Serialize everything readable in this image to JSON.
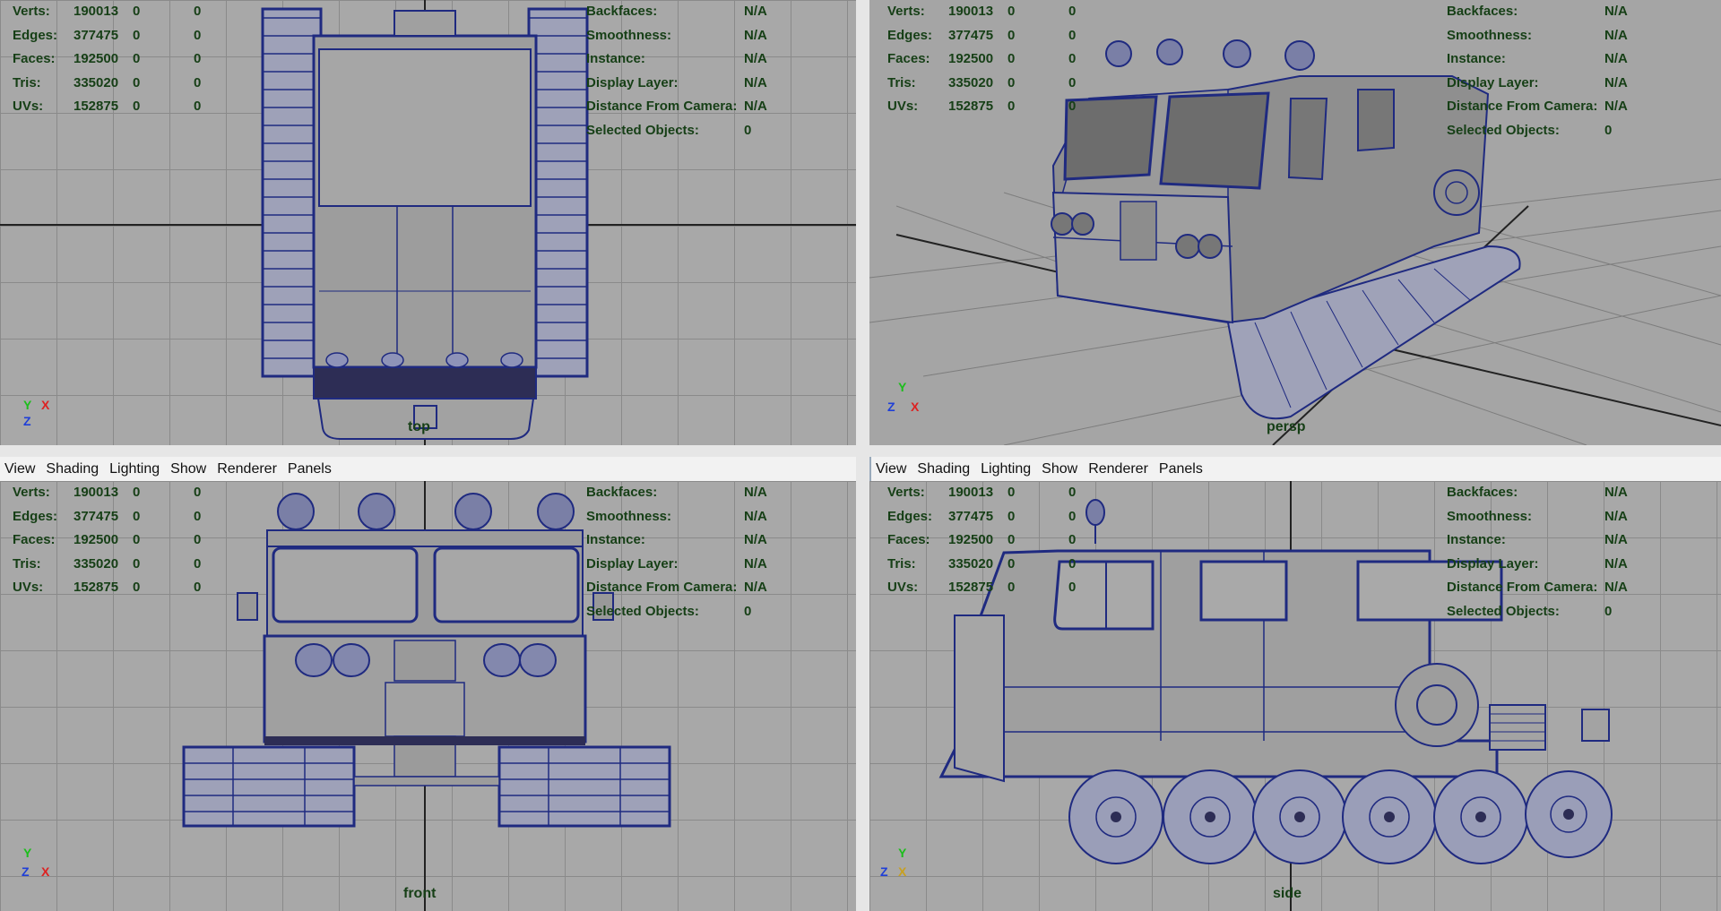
{
  "stats": {
    "left": [
      {
        "label": "Verts:",
        "value": "190013",
        "a": "0",
        "b": "0"
      },
      {
        "label": "Edges:",
        "value": "377475",
        "a": "0",
        "b": "0"
      },
      {
        "label": "Faces:",
        "value": "192500",
        "a": "0",
        "b": "0"
      },
      {
        "label": "Tris:",
        "value": "335020",
        "a": "0",
        "b": "0"
      },
      {
        "label": "UVs:",
        "value": "152875",
        "a": "0",
        "b": "0"
      }
    ],
    "right": [
      {
        "label": "Backfaces:",
        "value": "N/A"
      },
      {
        "label": "Smoothness:",
        "value": "N/A"
      },
      {
        "label": "Instance:",
        "value": "N/A"
      },
      {
        "label": "Display Layer:",
        "value": "N/A"
      },
      {
        "label": "Distance From Camera:",
        "value": "N/A"
      },
      {
        "label": "Selected Objects:",
        "value": "0"
      }
    ]
  },
  "menu": [
    "View",
    "Shading",
    "Lighting",
    "Show",
    "Renderer",
    "Panels"
  ],
  "viewports": {
    "top": {
      "camera": "top",
      "axis_a": "Y",
      "axis_b": "X",
      "axis_c": "Z"
    },
    "persp": {
      "camera": "persp",
      "axis_a": "Y",
      "axis_b": "X",
      "axis_c": "Z"
    },
    "front": {
      "camera": "front",
      "axis_a": "Y",
      "axis_b": "X",
      "axis_c": "Z"
    },
    "side": {
      "camera": "side",
      "axis_a": "Y",
      "axis_b": "X",
      "axis_c": "Z"
    }
  },
  "colors": {
    "wire": "#1f2a80",
    "hud": "#163f16",
    "grid": "#8a8a8a",
    "viewport": "#a8a8a8"
  }
}
